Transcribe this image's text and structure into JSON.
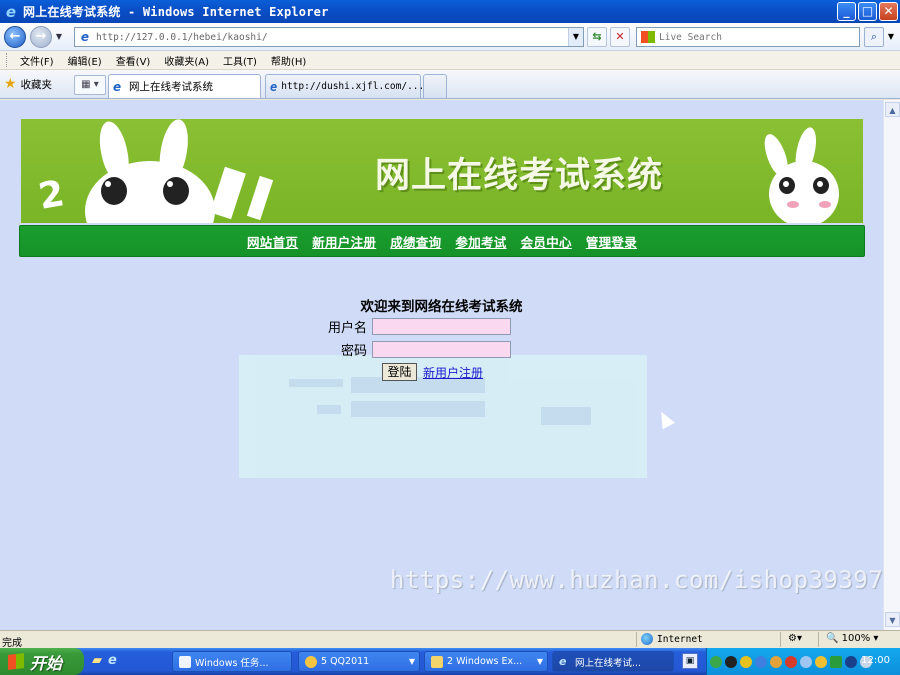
{
  "window": {
    "title": "网上在线考试系统 - Windows Internet Explorer"
  },
  "address": {
    "url": "http://127.0.0.1/hebei/kaoshi/"
  },
  "search": {
    "placeholder": "Live Search"
  },
  "menu": {
    "items": [
      "文件(F)",
      "编辑(E)",
      "查看(V)",
      "收藏夹(A)",
      "工具(T)",
      "帮助(H)"
    ]
  },
  "tabs": {
    "favorites_label": "收藏夹",
    "active_tab": "网上在线考试系统",
    "other_tab": "http://dushi.xjfl.com/..."
  },
  "page": {
    "banner_title": "网上在线考试系统",
    "banner_number": "2",
    "nav": [
      "网站首页",
      "新用户注册",
      "成绩查询",
      "参加考试",
      "会员中心",
      "管理登录"
    ],
    "welcome": "欢迎来到网络在线考试系统",
    "username_label": "用户名",
    "password_label": "密码",
    "login_button": "登陆",
    "register_link": "新用户注册",
    "watermark": "https://www.huzhan.com/ishop39397"
  },
  "status": {
    "text": "完成",
    "zone": "Internet",
    "zoom": "100%"
  },
  "taskbar": {
    "start": "开始",
    "buttons": [
      {
        "label": "Windows 任务..."
      },
      {
        "label": "5 QQ2011"
      },
      {
        "label": "2 Windows Ex..."
      },
      {
        "label": "网上在线考试..."
      }
    ],
    "clock": "12:00"
  }
}
